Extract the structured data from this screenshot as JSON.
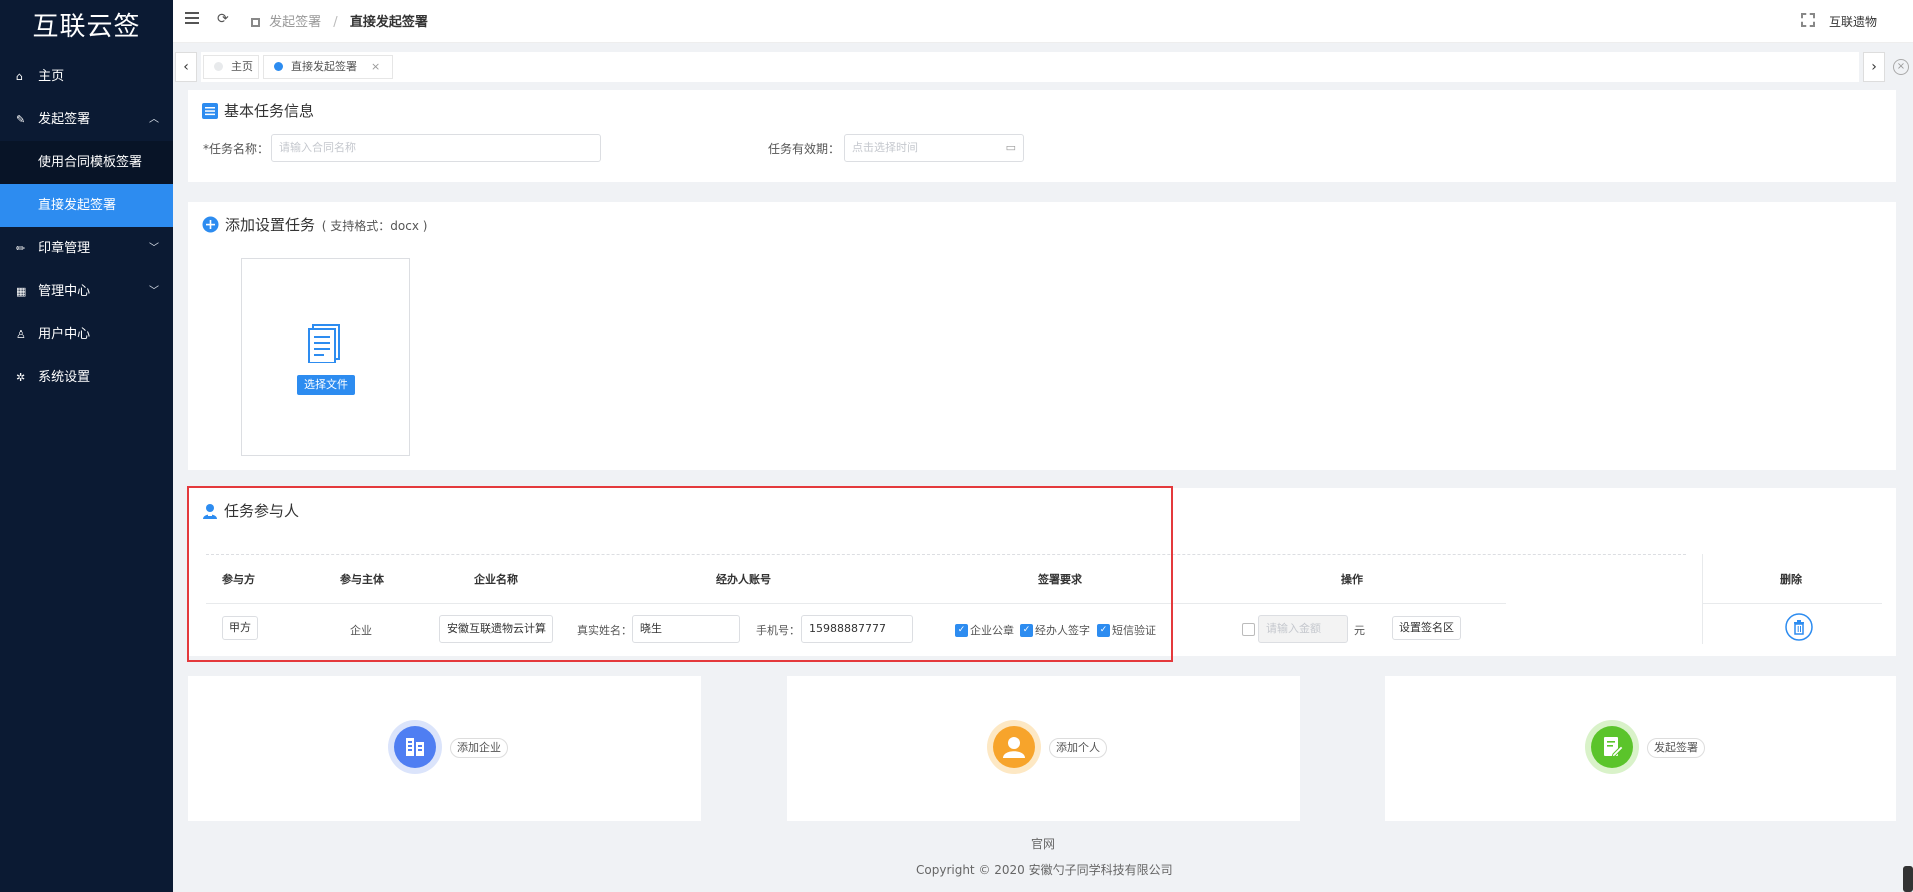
{
  "app": {
    "logo": "互联云签"
  },
  "sidebar": {
    "items": [
      {
        "label": "主页",
        "icon": "home-icon"
      },
      {
        "label": "发起签署",
        "icon": "edit-icon",
        "expanded": true,
        "children": [
          {
            "label": "使用合同模板签署"
          },
          {
            "label": "直接发起签署",
            "active": true
          }
        ]
      },
      {
        "label": "印章管理",
        "icon": "pen-icon"
      },
      {
        "label": "管理中心",
        "icon": "grid-icon"
      },
      {
        "label": "用户中心",
        "icon": "user-icon"
      },
      {
        "label": "系统设置",
        "icon": "gear-icon"
      }
    ]
  },
  "header": {
    "breadcrumb": [
      "发起签署",
      "直接发起签署"
    ],
    "user": "互联遗物"
  },
  "tabs": [
    {
      "label": "主页",
      "active": false
    },
    {
      "label": "直接发起签署",
      "active": true,
      "close": "×"
    }
  ],
  "basic": {
    "title": "基本任务信息",
    "task_name_label": "*任务名称：",
    "task_name_placeholder": "请输入合同名称",
    "validity_label": "任务有效期：",
    "validity_placeholder": "点击选择时间"
  },
  "upload": {
    "title": "添加设置任务",
    "format_hint": "( 支持格式：docx )",
    "button": "选择文件"
  },
  "participants": {
    "title": "任务参与人",
    "headers": {
      "party": "参与方",
      "subject": "参与主体",
      "company": "企业名称",
      "account": "经办人账号",
      "requirements": "签署要求",
      "operation": "操作",
      "delete": "删除"
    },
    "row": {
      "party": "甲方",
      "subject": "企业",
      "company": "安徽互联遗物云计算",
      "real_name_label": "真实姓名：",
      "real_name": "晓生",
      "phone_label": "手机号：",
      "phone": "15988887777",
      "req_seal": "企业公章",
      "req_handler_sign": "经办人签字",
      "req_sms": "短信验证",
      "amount_placeholder": "请输入金额",
      "amount_unit": "元",
      "set_sign_area": "设置签名区"
    }
  },
  "actions": {
    "add_company": "添加企业",
    "add_person": "添加个人",
    "start_sign": "发起签署"
  },
  "colors": {
    "sidebar_bg": "#0b1a33",
    "accent": "#2d8cf0",
    "highlight_border": "#e4393c"
  },
  "footer": {
    "link": "官网",
    "copyright": "Copyright © 2020 安徽勺子同学科技有限公司"
  }
}
